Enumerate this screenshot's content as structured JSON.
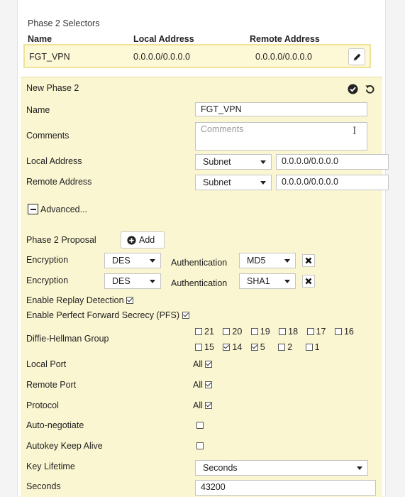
{
  "selectors": {
    "title": "Phase 2 Selectors",
    "col_name": "Name",
    "col_local": "Local Address",
    "col_remote": "Remote Address",
    "row": {
      "name": "FGT_VPN",
      "local": "0.0.0.0/0.0.0.0",
      "remote": "0.0.0.0/0.0.0.0"
    }
  },
  "phase2": {
    "title": "New Phase 2",
    "name_label": "Name",
    "name_value": "FGT_VPN",
    "comments_label": "Comments",
    "comments_placeholder": "Comments",
    "local_label": "Local Address",
    "local_type": "Subnet",
    "local_value": "0.0.0.0/0.0.0.0",
    "remote_label": "Remote Address",
    "remote_type": "Subnet",
    "remote_value": "0.0.0.0/0.0.0.0",
    "advanced_label": "Advanced..."
  },
  "proposal": {
    "label": "Phase 2 Proposal",
    "add_label": "Add",
    "rows": [
      {
        "enc_label": "Encryption",
        "enc": "DES",
        "auth_label": "Authentication",
        "auth": "MD5"
      },
      {
        "enc_label": "Encryption",
        "enc": "DES",
        "auth_label": "Authentication",
        "auth": "SHA1"
      }
    ]
  },
  "options": {
    "replay_label": "Enable Replay Detection",
    "replay_checked": true,
    "pfs_label": "Enable Perfect Forward Secrecy (PFS)",
    "pfs_checked": true,
    "dh_label": "Diffie-Hellman Group",
    "dh_row1": [
      {
        "value": "21",
        "checked": false
      },
      {
        "value": "20",
        "checked": false
      },
      {
        "value": "19",
        "checked": false
      },
      {
        "value": "18",
        "checked": false
      },
      {
        "value": "17",
        "checked": false
      },
      {
        "value": "16",
        "checked": false
      }
    ],
    "dh_row2": [
      {
        "value": "15",
        "checked": false
      },
      {
        "value": "14",
        "checked": true
      },
      {
        "value": "5",
        "checked": true
      },
      {
        "value": "2",
        "checked": false
      },
      {
        "value": "1",
        "checked": false
      }
    ],
    "local_port_label": "Local Port",
    "local_port_all": "All",
    "remote_port_label": "Remote Port",
    "remote_port_all": "All",
    "protocol_label": "Protocol",
    "protocol_all": "All",
    "autoneg_label": "Auto-negotiate",
    "keepalive_label": "Autokey Keep Alive",
    "lifetime_label": "Key Lifetime",
    "lifetime_value": "Seconds",
    "seconds_label": "Seconds",
    "seconds_value": "43200"
  }
}
